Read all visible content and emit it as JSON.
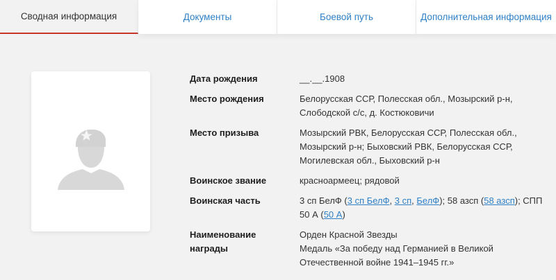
{
  "tabs": {
    "summary": "Сводная информация",
    "documents": "Документы",
    "combat_path": "Боевой путь",
    "additional": "Дополнительная информация"
  },
  "photo": {
    "icon": "soldier-silhouette-icon"
  },
  "fields": {
    "birth_date": {
      "label": "Дата рождения",
      "value": "__.__.1908"
    },
    "birth_place": {
      "label": "Место рождения",
      "value": "Белорусская ССР, Полесская обл., Мозырский р-н, Слободской с/с, д. Костюковичи"
    },
    "draft_place": {
      "label": "Место призыва",
      "value": "Мозырский РВК, Белорусская ССР, Полесская обл., Мозырский р-н; Быховский РВК, Белорусская ССР, Могилевская обл., Быховский р-н"
    },
    "rank": {
      "label": "Воинское звание",
      "value": "красноармеец; рядовой"
    },
    "unit": {
      "label": "Воинская часть",
      "t1": "3 сп БелФ (",
      "l1": "3 сп БелФ",
      "t2": ", ",
      "l2": "3 сп",
      "t3": ", ",
      "l3": "БелФ",
      "t4": "); 58 азсп (",
      "l4": "58 азсп",
      "t5": "); СПП 50 А (",
      "l5": "50 А",
      "t6": ")"
    },
    "award": {
      "label_line1": "Наименование",
      "label_line2": "награды",
      "line1": "Орден Красной Звезды",
      "line2": "Медаль «За победу над Германией в Великой Отечественной войне 1941–1945 гг.»"
    }
  },
  "colors": {
    "accent": "#c8332a",
    "link": "#2f80c6",
    "background": "#f2f2f2"
  }
}
